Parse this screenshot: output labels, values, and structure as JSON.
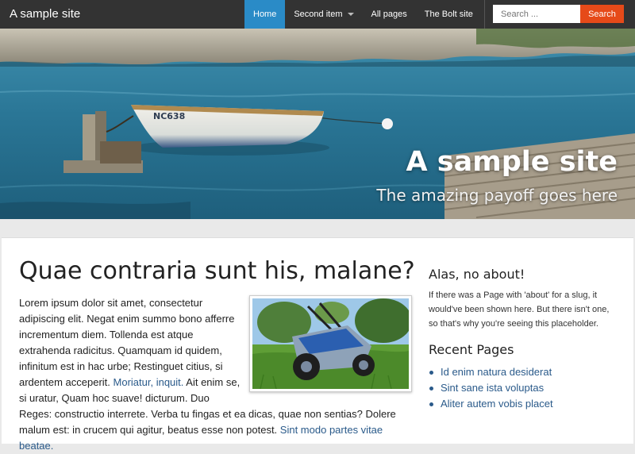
{
  "header": {
    "brand": "A sample site",
    "nav": [
      {
        "label": "Home",
        "active": true
      },
      {
        "label": "Second item",
        "dropdown": true
      },
      {
        "label": "All pages"
      },
      {
        "label": "The Bolt site"
      }
    ],
    "search": {
      "placeholder": "Search ...",
      "button_label": "Search"
    },
    "colors": {
      "bar": "#333333",
      "active": "#2a8bc7",
      "search_button": "#e64a19"
    }
  },
  "hero": {
    "title": "A sample site",
    "subtitle": "The amazing payoff goes here",
    "boat_number": "NC638"
  },
  "article": {
    "title": "Quae contraria sunt his, malane?",
    "body": [
      {
        "t": "Lorem ipsum dolor sit amet, consectetur adipiscing elit. Negat enim summo bono afferre incrementum diem. Tollenda est atque extrahenda radicitus. Quamquam id quidem, infinitum est in hac urbe; Restinguet citius, si ardentem acceperit. "
      },
      {
        "t": "Moriatur, inquit.",
        "link": true
      },
      {
        "t": " Ait enim se, si uratur, Quam hoc suave! dicturum. Duo Reges: constructio interrete. Verba tu fingas et ea dicas, quae non sentias? Dolere malum est: in crucem qui agitur, beatus esse non potest. "
      },
      {
        "t": "Sint modo partes vitae beatae.",
        "link": true
      }
    ]
  },
  "sidebar": {
    "about_title": "Alas, no about!",
    "about_text": "If there was a Page with 'about' for a slug, it would've been shown here. But there isn't one, so that's why you're seeing this placeholder.",
    "recent_title": "Recent Pages",
    "recent_pages": [
      "Id enim natura desiderat",
      "Sint sane ista voluptas",
      "Aliter autem vobis placet"
    ]
  }
}
